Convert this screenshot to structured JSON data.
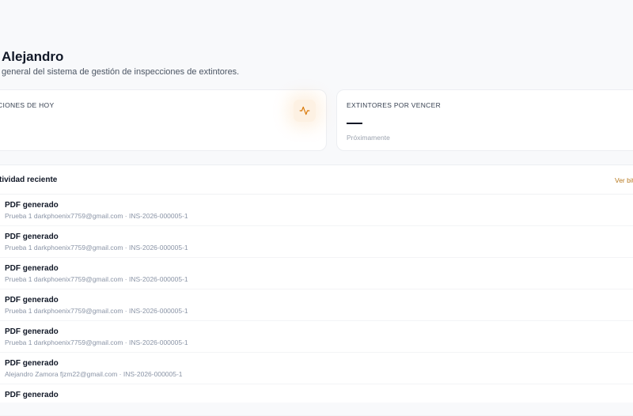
{
  "header": {
    "greeting": "Alejandro",
    "subtitle": "general del sistema de gestión de inspecciones de extintores."
  },
  "stats": {
    "today": {
      "label": "CIONES DE HOY",
      "icon": "activity-icon",
      "accent": "#d97706"
    },
    "expiring": {
      "label": "EXTINTORES POR VENCER",
      "value": "—",
      "footnote": "Próximamente"
    }
  },
  "activity": {
    "title": "tividad reciente",
    "view_all": "Ver bit",
    "items": [
      {
        "title": "PDF generado",
        "detail": "Prueba 1 darkphoenix7759@gmail.com · INS-2026-000005-1"
      },
      {
        "title": "PDF generado",
        "detail": "Prueba 1 darkphoenix7759@gmail.com · INS-2026-000005-1"
      },
      {
        "title": "PDF generado",
        "detail": "Prueba 1 darkphoenix7759@gmail.com · INS-2026-000005-1"
      },
      {
        "title": "PDF generado",
        "detail": "Prueba 1 darkphoenix7759@gmail.com · INS-2026-000005-1"
      },
      {
        "title": "PDF generado",
        "detail": "Prueba 1 darkphoenix7759@gmail.com · INS-2026-000005-1"
      },
      {
        "title": "PDF generado",
        "detail": "Alejandro Zamora fjzm22@gmail.com · INS-2026-000005-1"
      },
      {
        "title": "PDF generado",
        "detail": ""
      }
    ]
  }
}
